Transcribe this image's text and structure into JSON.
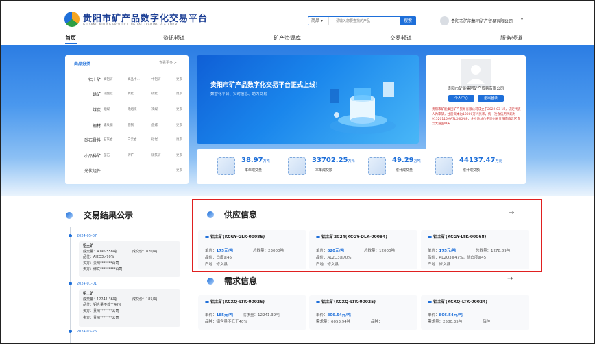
{
  "header": {
    "title": "贵阳市矿产品数字化交易平台",
    "subtitle": "GUIYANG MINING PRODUCT DIGITAL TRADING PLATFORM",
    "search_type": "商品",
    "search_placeholder": "请输入您要查找的产品",
    "search_button": "搜索",
    "company": "贵阳市矿能集团矿产贸易有限公司"
  },
  "nav": {
    "items": [
      "首页",
      "资讯频道",
      "矿产资源库",
      "交易频道",
      "服务频道"
    ]
  },
  "category": {
    "title": "商品分类",
    "more": "查看更多 >",
    "rows": [
      {
        "name": "铝土矿",
        "subs": [
          "高铝矿",
          "高品中...",
          "中铝矿"
        ],
        "more": "更多"
      },
      {
        "name": "锰矿",
        "subs": [
          "碳酸锰",
          "氧锰",
          "硫锰"
        ],
        "more": "更多"
      },
      {
        "name": "煤炭",
        "subs": [
          "烟煤",
          "无烟煤",
          "褐煤"
        ],
        "more": "更多"
      },
      {
        "name": "钢材",
        "subs": [
          "螺纹钢",
          "圆钢",
          "盘螺"
        ],
        "more": "更多"
      },
      {
        "name": "砂石骨料",
        "subs": [
          "石灰岩",
          "白云岩",
          "砂岩"
        ],
        "more": "更多"
      },
      {
        "name": "小品种矿",
        "subs": [
          "萤石",
          "钾矿",
          "硫铁矿"
        ],
        "more": "更多"
      },
      {
        "name": "光伏组件",
        "subs": [],
        "more": "更多"
      }
    ]
  },
  "banner": {
    "title": "贵阳市矿产品数字化交易平台正式上线！",
    "subtitle": "数智化平台、实时信息、助力交易"
  },
  "profile": {
    "name": "贵阳市矿能集团矿产贸易有限公司",
    "btn_center": "个人中心",
    "btn_logout": "退出登录",
    "desc": "贵阳市矿能集团矿产贸易有限公司成立于2022-03-15，法定代表人为李某，注册资本为10000万人民币，统一社会信用代码为91520115MA7LX6KP8P，企业地址位于贵州省贵阳市白云区白云大道国中天..."
  },
  "stats": [
    {
      "value": "38.97",
      "unit": "万吨",
      "label": "本年成交量"
    },
    {
      "value": "33702.25",
      "unit": "万元",
      "label": "本年成交额"
    },
    {
      "value": "49.29",
      "unit": "万吨",
      "label": "累计成交量"
    },
    {
      "value": "44137.47",
      "unit": "万元",
      "label": "累计成交额"
    }
  ],
  "results": {
    "title": "交易结果公示",
    "items": [
      {
        "date": "2024-05-07",
        "name": "铝土矿",
        "qty": "成交量：4096.558吨",
        "price": "成交价：820/吨",
        "grade": "品位：Al2O3>70%",
        "buyer": "买方：贵州*******公司",
        "seller": "卖方：修文*********公司"
      },
      {
        "date": "2024-01-01",
        "name": "铝土矿",
        "qty": "成交量：12241.36吨",
        "price": "成交价：185/吨",
        "grade": "品位：铝含量不低于40%",
        "buyer": "买方：贵州*******公司",
        "seller": "卖方：贵州*******公司"
      }
    ],
    "next_date": "2024-03-26"
  },
  "supply": {
    "title": "供应信息",
    "arrow": "→",
    "items": [
      {
        "title": "铝土矿(KCGY-GLK-00085)",
        "price": "175元/吨",
        "total": "总数量：23000吨",
        "grade": "品位：白度≥45",
        "origin": "产地：修文县"
      },
      {
        "title": "铝土矿2024(KCGY-DLK-00084)",
        "price": "820元/吨",
        "total": "总数量：12000吨",
        "grade": "品位：AL2O3≥70%",
        "origin": "产地：修文县"
      },
      {
        "title": "铝土矿(KCGY-LTK-00068)",
        "price": "175元/吨",
        "total": "总数量：1278.89吨",
        "grade": "品位：AL2O3≥47%，烧白度≥45",
        "origin": "产地：修文县"
      }
    ]
  },
  "demand": {
    "title": "需求信息",
    "arrow": "→",
    "items": [
      {
        "title": "铝土矿(KCXQ-LTK-00026)",
        "price": "185元/吨",
        "total": "需求量：12241.39吨",
        "grade": "品种：铝含量不低于40%"
      },
      {
        "title": "铝土矿(KCXQ-LTK-00025)",
        "price": "806.54元/吨",
        "total": "需求量：6053.94吨",
        "grade": "品种："
      },
      {
        "title": "铝土矿(KCXQ-LTK-00024)",
        "price": "806.54元/吨",
        "total": "需求量：2580.35吨",
        "grade": "品种："
      }
    ]
  },
  "labels": {
    "price": "单价：",
    "grade_prefix": "品位："
  }
}
